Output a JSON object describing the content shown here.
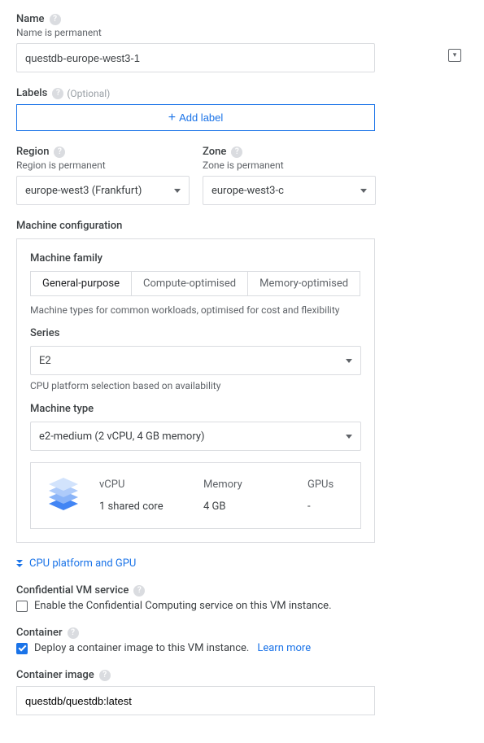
{
  "name": {
    "label": "Name",
    "hint": "Name is permanent",
    "value": "questdb-europe-west3-1"
  },
  "labels": {
    "label": "Labels",
    "optional": "(Optional)",
    "add_button": "Add label"
  },
  "region": {
    "label": "Region",
    "hint": "Region is permanent",
    "value": "europe-west3 (Frankfurt)"
  },
  "zone": {
    "label": "Zone",
    "hint": "Zone is permanent",
    "value": "europe-west3-c"
  },
  "machine_config": {
    "title": "Machine configuration",
    "family_label": "Machine family",
    "tabs": [
      "General-purpose",
      "Compute-optimised",
      "Memory-optimised"
    ],
    "description": "Machine types for common workloads, optimised for cost and flexibility",
    "series_label": "Series",
    "series_value": "E2",
    "series_helper": "CPU platform selection based on availability",
    "type_label": "Machine type",
    "type_value": "e2-medium (2 vCPU, 4 GB memory)",
    "specs": {
      "vcpu_label": "vCPU",
      "vcpu_value": "1 shared core",
      "memory_label": "Memory",
      "memory_value": "4 GB",
      "gpus_label": "GPUs",
      "gpus_value": "-"
    }
  },
  "expand_link": "CPU platform and GPU",
  "confidential": {
    "label": "Confidential VM service",
    "checkbox_label": "Enable the Confidential Computing service on this VM instance."
  },
  "container": {
    "label": "Container",
    "checkbox_label": "Deploy a container image to this VM instance.",
    "learn_more": "Learn more"
  },
  "container_image": {
    "label": "Container image",
    "value": "questdb/questdb:latest"
  }
}
